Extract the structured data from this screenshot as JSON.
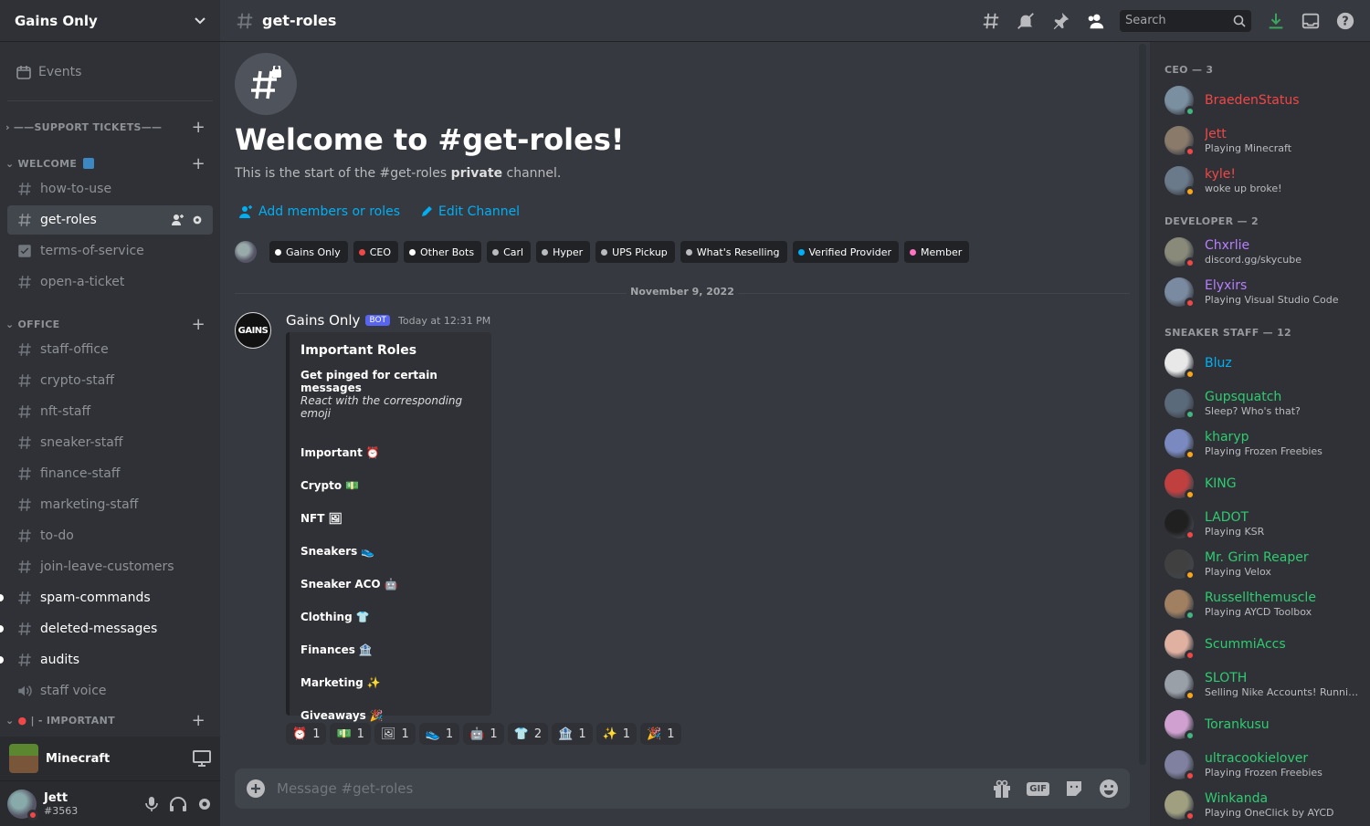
{
  "server": {
    "name": "Gains Only",
    "events_label": "Events"
  },
  "sidebar": {
    "categories": [
      {
        "name": "——SUPPORT TICKETS——"
      },
      {
        "name": "WELCOME"
      },
      {
        "name": "OFFICE"
      },
      {
        "name": "| - IMPORTANT"
      }
    ],
    "welcome_channels": [
      "how-to-use",
      "get-roles",
      "terms-of-service",
      "open-a-ticket"
    ],
    "office_channels": [
      "staff-office",
      "crypto-staff",
      "nft-staff",
      "sneaker-staff",
      "finance-staff",
      "marketing-staff",
      "to-do",
      "join-leave-customers",
      "spam-commands",
      "deleted-messages",
      "audits",
      "staff voice"
    ]
  },
  "activity": {
    "name": "Minecraft"
  },
  "user": {
    "name": "Jett",
    "tag": "#3563"
  },
  "channel": {
    "name": "get-roles"
  },
  "search": {
    "placeholder": "Search"
  },
  "welcome": {
    "title": "Welcome to #get-roles!",
    "sub_prefix": "This is the start of the #get-roles ",
    "sub_bold": "private",
    "sub_suffix": " channel.",
    "add_members": "Add members or roles",
    "edit_channel": "Edit Channel"
  },
  "roles": [
    {
      "name": "Gains Only",
      "color": "#ffffff"
    },
    {
      "name": "CEO",
      "color": "#f04747"
    },
    {
      "name": "Other Bots",
      "color": "#ffffff"
    },
    {
      "name": "Carl",
      "color": "#b9bbbe"
    },
    {
      "name": "Hyper",
      "color": "#b9bbbe"
    },
    {
      "name": "UPS Pickup",
      "color": "#b9bbbe"
    },
    {
      "name": "What's Reselling",
      "color": "#b9bbbe"
    },
    {
      "name": "Verified Provider",
      "color": "#00b0f4"
    },
    {
      "name": "Member",
      "color": "#ff73c1"
    }
  ],
  "date_divider": "November 9, 2022",
  "message": {
    "author": "Gains Only",
    "bot_tag": "BOT",
    "time": "Today at 12:31 PM",
    "avatar_text": "GAINS",
    "embed": {
      "title": "Important Roles",
      "field_name": "Get pinged for certain messages",
      "field_value": "React with the corresponding emoji",
      "roles": [
        {
          "label": "Important",
          "emoji": "⏰"
        },
        {
          "label": "Crypto",
          "emoji": "💵"
        },
        {
          "label": "NFT",
          "emoji": "🖼"
        },
        {
          "label": "Sneakers",
          "emoji": "👟"
        },
        {
          "label": "Sneaker ACO",
          "emoji": "🤖"
        },
        {
          "label": "Clothing",
          "emoji": "👕"
        },
        {
          "label": "Finances",
          "emoji": "🏦"
        },
        {
          "label": "Marketing",
          "emoji": "✨"
        },
        {
          "label": "Giveaways",
          "emoji": "🎉"
        }
      ]
    },
    "reactions": [
      {
        "emoji": "⏰",
        "count": "1"
      },
      {
        "emoji": "💵",
        "count": "1"
      },
      {
        "emoji": "🖼",
        "count": "1"
      },
      {
        "emoji": "👟",
        "count": "1"
      },
      {
        "emoji": "🤖",
        "count": "1"
      },
      {
        "emoji": "👕",
        "count": "2"
      },
      {
        "emoji": "🏦",
        "count": "1"
      },
      {
        "emoji": "✨",
        "count": "1"
      },
      {
        "emoji": "🎉",
        "count": "1"
      }
    ]
  },
  "composer": {
    "placeholder": "Message #get-roles",
    "gif_label": "GIF"
  },
  "members": {
    "groups": [
      {
        "title": "CEO — 3",
        "items": [
          {
            "name": "BraedenStatus",
            "activity": "",
            "color": "#f04747",
            "status": "#43b581",
            "avatar": "#7a8fa0"
          },
          {
            "name": "Jett",
            "activity": "Playing Minecraft",
            "color": "#f04747",
            "status": "#f04747",
            "avatar": "#8a7a6a"
          },
          {
            "name": "kyle!",
            "activity": "woke up broke!",
            "color": "#f04747",
            "status": "#faa61a",
            "avatar": "#6a7a8a"
          }
        ]
      },
      {
        "title": "DEVELOPER — 2",
        "items": [
          {
            "name": "Chxrlie",
            "activity": "discord.gg/skycube",
            "color": "#b87fff",
            "status": "#f04747",
            "avatar": "#8a8a7a"
          },
          {
            "name": "Elyxirs",
            "activity": "Playing Visual Studio Code",
            "color": "#b87fff",
            "status": "#f04747",
            "avatar": "#7a8aa0"
          }
        ]
      },
      {
        "title": "SNEAKER STAFF — 12",
        "items": [
          {
            "name": "Bluz",
            "activity": "",
            "color": "#00b0f4",
            "status": "#faa61a",
            "avatar": "#e8e8e8"
          },
          {
            "name": "Gupsquatch",
            "activity": "Sleep? Who's that?",
            "color": "#2ecc71",
            "status": "#43b581",
            "avatar": "#5a6a7a"
          },
          {
            "name": "kharyp",
            "activity": "Playing Frozen Freebies",
            "color": "#2ecc71",
            "status": "#faa61a",
            "avatar": "#7a8ac0"
          },
          {
            "name": "KING",
            "activity": "",
            "color": "#2ecc71",
            "status": "#faa61a",
            "avatar": "#c04040"
          },
          {
            "name": "LADOT",
            "activity": "Playing KSR",
            "color": "#2ecc71",
            "status": "#f04747",
            "avatar": "#202020"
          },
          {
            "name": "Mr. Grim Reaper",
            "activity": "Playing Velox",
            "color": "#2ecc71",
            "status": "#faa61a",
            "avatar": "#404040"
          },
          {
            "name": "Russellthemuscle",
            "activity": "Playing AYCD Toolbox",
            "color": "#2ecc71",
            "status": "#43b581",
            "avatar": "#a08060"
          },
          {
            "name": "ScummiAccs",
            "activity": "",
            "color": "#2ecc71",
            "status": "#f04747",
            "avatar": "#e0b0a0"
          },
          {
            "name": "SLOTH",
            "activity": "Selling Nike Accounts! Runnin...",
            "color": "#2ecc71",
            "status": "#faa61a",
            "avatar": "#9aa0a8"
          },
          {
            "name": "Torankusu",
            "activity": "",
            "color": "#2ecc71",
            "status": "#43b581",
            "avatar": "#d0a0d0"
          },
          {
            "name": "ultracookielover",
            "activity": "Playing Frozen Freebies",
            "color": "#2ecc71",
            "status": "#f04747",
            "avatar": "#8080a0"
          },
          {
            "name": "Winkanda",
            "activity": "Playing OneClick by AYCD",
            "color": "#2ecc71",
            "status": "#f04747",
            "avatar": "#a0a080"
          }
        ]
      }
    ]
  }
}
